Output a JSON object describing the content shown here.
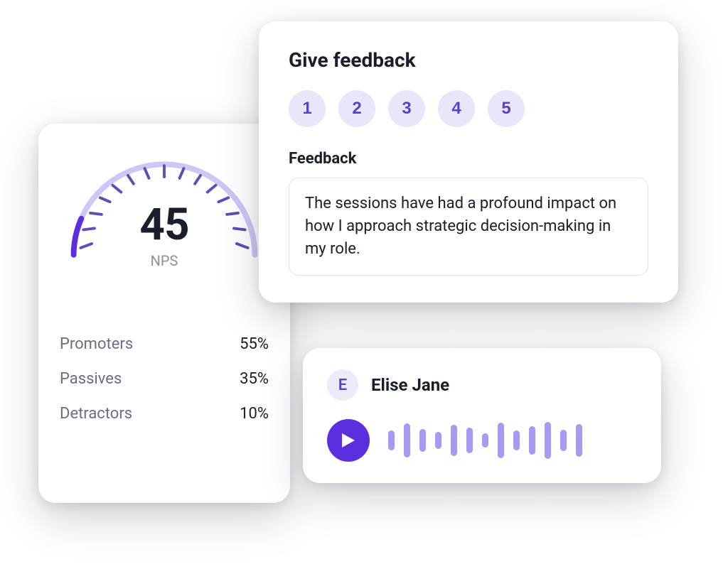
{
  "nps": {
    "value": "45",
    "label": "NPS",
    "breakdown": [
      {
        "label": "Promoters",
        "value": "55%"
      },
      {
        "label": "Passives",
        "value": "35%"
      },
      {
        "label": "Detractors",
        "value": "10%"
      }
    ]
  },
  "feedback": {
    "title": "Give feedback",
    "rating_options": [
      "1",
      "2",
      "3",
      "4",
      "5"
    ],
    "sub_label": "Feedback",
    "text": "The sessions have had a profound impact on how I approach strategic decision-making in my role."
  },
  "audio": {
    "avatar_initial": "E",
    "name": "Elise Jane",
    "waveform_heights": [
      28,
      48,
      32,
      24,
      44,
      36,
      20,
      50,
      28,
      40,
      52,
      30,
      46
    ]
  },
  "colors": {
    "accent": "#5b2fe0",
    "accent_light": "#a79af0",
    "chip_bg": "#e9e6fa"
  }
}
